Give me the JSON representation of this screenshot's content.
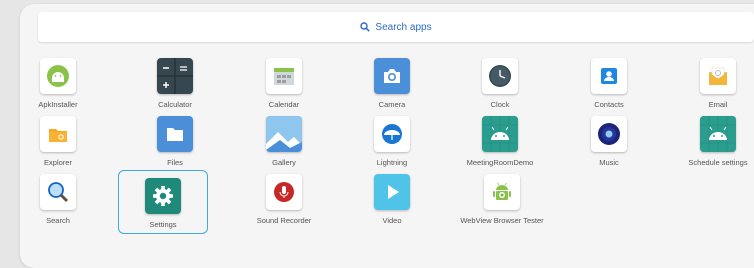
{
  "search": {
    "label": "Search apps",
    "icon": "search-icon"
  },
  "apps": [
    {
      "label": "ApkInstaller",
      "icon": "android-installer-icon"
    },
    {
      "label": "Calculator",
      "icon": "calculator-icon"
    },
    {
      "label": "Calendar",
      "icon": "calendar-icon"
    },
    {
      "label": "Camera",
      "icon": "camera-icon"
    },
    {
      "label": "Clock",
      "icon": "clock-icon"
    },
    {
      "label": "Contacts",
      "icon": "contacts-icon"
    },
    {
      "label": "Email",
      "icon": "email-icon"
    },
    {
      "label": "Explorer",
      "icon": "folder-explorer-icon"
    },
    {
      "label": "Files",
      "icon": "folder-icon"
    },
    {
      "label": "Gallery",
      "icon": "gallery-icon"
    },
    {
      "label": "Lightning",
      "icon": "lightning-browser-icon"
    },
    {
      "label": "MeetingRoomDemo",
      "icon": "android-app-icon"
    },
    {
      "label": "Music",
      "icon": "music-speaker-icon"
    },
    {
      "label": "Schedule settings",
      "icon": "android-app-icon"
    },
    {
      "label": "Search",
      "icon": "magnifier-icon"
    },
    {
      "label": "Settings",
      "icon": "gear-icon"
    },
    {
      "label": "Sound Recorder",
      "icon": "microphone-icon"
    },
    {
      "label": "Video",
      "icon": "play-icon"
    },
    {
      "label": "WebView Browser Tester",
      "icon": "android-app-icon"
    }
  ],
  "colors": {
    "accent": "#2b6cc4",
    "focus": "#3fa9e0"
  }
}
